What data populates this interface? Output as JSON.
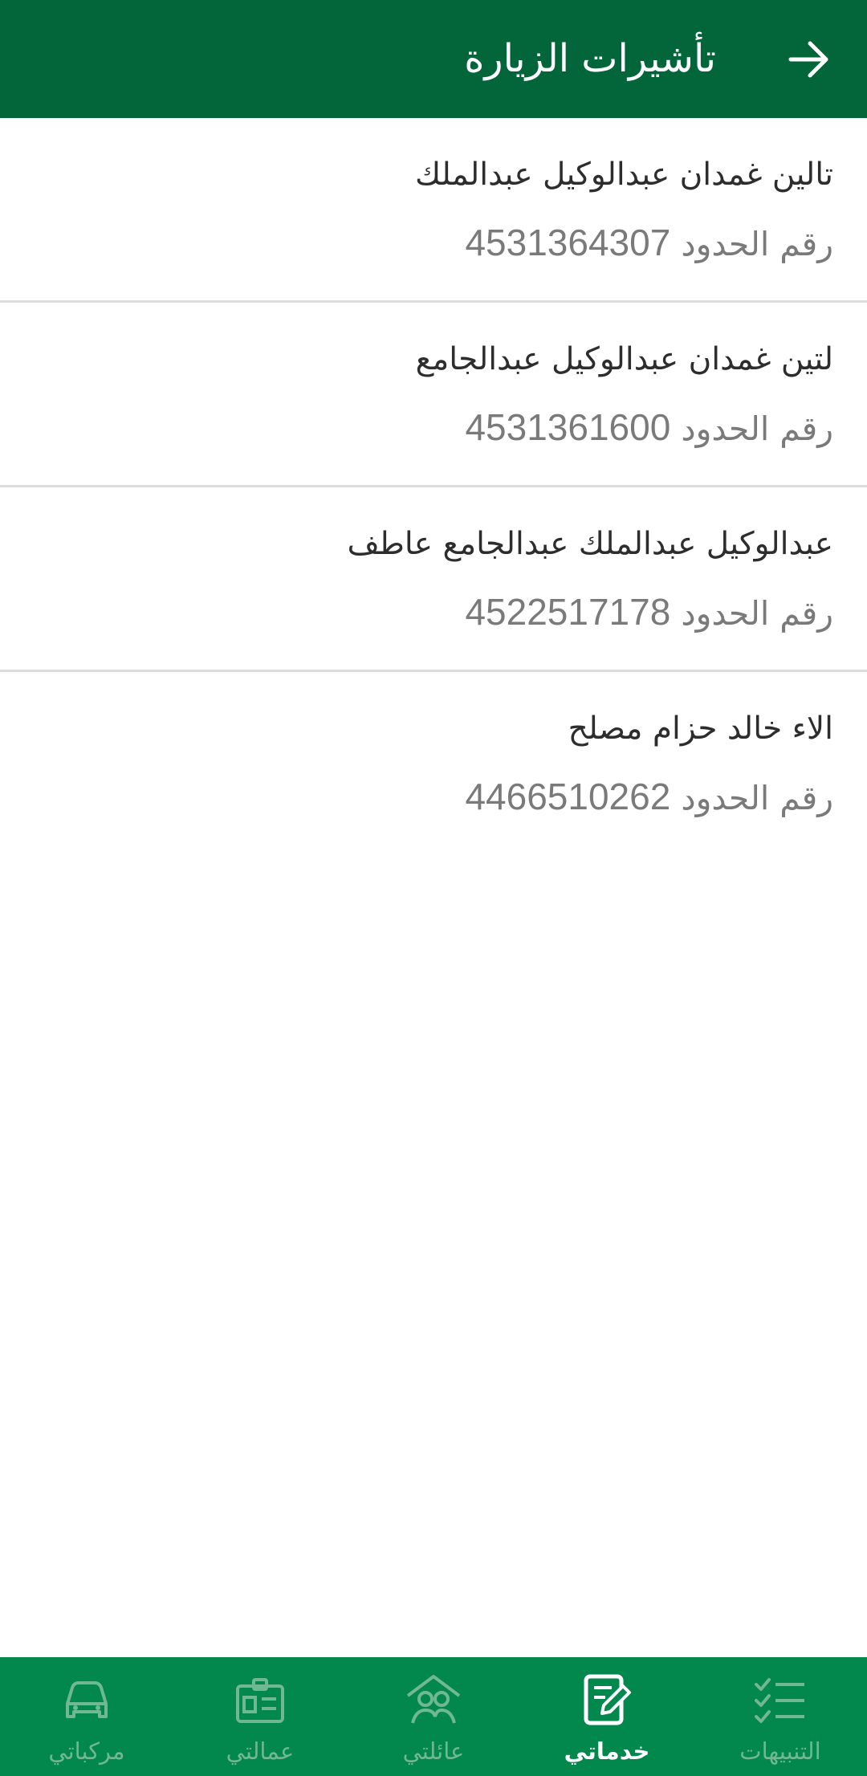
{
  "header": {
    "title": "تأشيرات الزيارة",
    "back_icon": "arrow-back-icon",
    "background": "#03653a"
  },
  "visas": [
    {
      "name": "تالين غمدان عبدالوكيل عبدالملك",
      "border_label": "رقم الحدود",
      "border_number": "4531364307"
    },
    {
      "name": "لتين غمدان عبدالوكيل عبدالجامع",
      "border_label": "رقم الحدود",
      "border_number": "4531361600"
    },
    {
      "name": "عبدالوكيل عبدالملك عبدالجامع عاطف",
      "border_label": "رقم الحدود",
      "border_number": "4522517178"
    },
    {
      "name": "الاء خالد حزام مصلح",
      "border_label": "رقم الحدود",
      "border_number": "4466510262"
    }
  ],
  "bottom_nav": {
    "background": "#02874d",
    "items": [
      {
        "label": "مركباتي",
        "icon": "car-icon",
        "active": false
      },
      {
        "label": "عمالتي",
        "icon": "id-card-icon",
        "active": false
      },
      {
        "label": "عائلتي",
        "icon": "family-icon",
        "active": false
      },
      {
        "label": "خدماتي",
        "icon": "edit-document-icon",
        "active": true
      },
      {
        "label": "التنبيهات",
        "icon": "checklist-icon",
        "active": false
      }
    ]
  }
}
